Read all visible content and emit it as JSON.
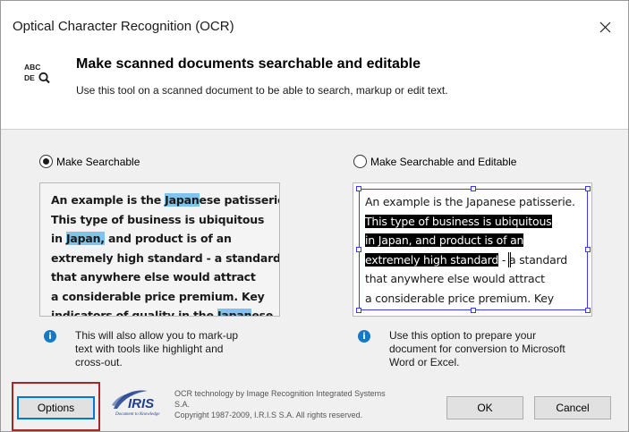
{
  "window": {
    "title": "Optical Character Recognition (OCR)"
  },
  "header": {
    "icon": "abc-deq-icon",
    "icon_text_top": "ABC",
    "icon_text_bottom": "DE",
    "title": "Make scanned documents searchable and editable",
    "subtitle": "Use this tool on a scanned document to be able to search, markup or edit text."
  },
  "options": {
    "searchable": {
      "label": "Make Searchable",
      "selected": true,
      "preview_lines": [
        {
          "before": "An example is the ",
          "hl": "Japan",
          "after": "ese patisserie."
        },
        {
          "before": "This type of business is ubiquitous",
          "hl": "",
          "after": ""
        },
        {
          "before": "in ",
          "hl": "Japan,",
          "after": " and product is of an"
        },
        {
          "before": "extremely high standard - a standard",
          "hl": "",
          "after": ""
        },
        {
          "before": "that anywhere else would attract",
          "hl": "",
          "after": ""
        },
        {
          "before": "a considerable price premium. Key",
          "hl": "",
          "after": ""
        },
        {
          "before": "indicators of quality in the ",
          "hl": "Japan",
          "after": "ese"
        }
      ],
      "info": [
        "This will also allow you to mark-up",
        "text with tools like highlight and",
        "cross-out."
      ]
    },
    "editable": {
      "label": "Make Searchable and Editable",
      "selected": false,
      "preview_lines": [
        {
          "hl": "",
          "after": "An example is the Japanese patisserie."
        },
        {
          "hl": "This type of business is ubiquitous",
          "after": ""
        },
        {
          "hl": "in Japan, and product is of an",
          "after": ""
        },
        {
          "hl": "extremely high standard",
          "after": " - a standard"
        },
        {
          "hl": "",
          "after": "that anywhere else would attract"
        },
        {
          "hl": "",
          "after": "a considerable price premium. Key"
        }
      ],
      "info": [
        "Use this option to prepare your",
        "document for conversion to Microsoft",
        "Word or Excel."
      ]
    }
  },
  "footer": {
    "options_label": "Options",
    "ok_label": "OK",
    "cancel_label": "Cancel",
    "logo": "iris-logo",
    "logo_word": "IRIS",
    "logo_tagline": "Document to Knowledge",
    "credit_lines": [
      "OCR technology by Image Recognition Integrated Systems",
      "S.A.",
      "Copyright 1987-2009, I.R.I.S S.A. All rights reserved."
    ]
  },
  "colors": {
    "search_highlight": "#7fc4ee",
    "edit_highlight": "#000000",
    "selection_border": "#3a3aff",
    "info_icon": "#1479c7",
    "options_focus": "#0078d7",
    "options_callout": "#a6262a"
  }
}
